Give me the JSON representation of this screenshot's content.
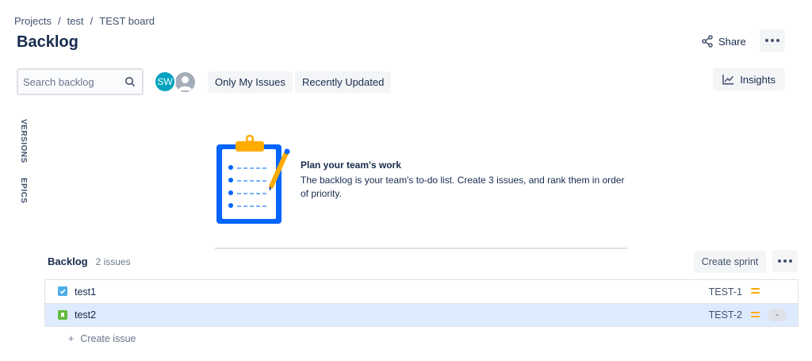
{
  "breadcrumb": {
    "items": [
      "Projects",
      "test",
      "TEST board"
    ],
    "separator": "/"
  },
  "page": {
    "title": "Backlog"
  },
  "header": {
    "share_label": "Share"
  },
  "search": {
    "placeholder": "Search backlog",
    "value": ""
  },
  "avatars": [
    {
      "initials": "SW",
      "color": "#00a3bf"
    },
    {
      "initials": "",
      "color": "#a5adba"
    }
  ],
  "filters": {
    "only_my_issues": "Only My Issues",
    "recently_updated": "Recently Updated"
  },
  "insights": {
    "label": "Insights"
  },
  "side_tabs": {
    "versions": "VERSIONS",
    "epics": "EPICS"
  },
  "empty_state": {
    "title": "Plan your team's work",
    "text": "The backlog is your team's to-do list. Create 3 issues, and rank them in order of priority."
  },
  "backlog": {
    "title": "Backlog",
    "count": "2 issues",
    "create_sprint_label": "Create sprint",
    "issues": [
      {
        "type": "task",
        "summary": "test1",
        "key": "TEST-1",
        "priority": "medium",
        "estimate": ""
      },
      {
        "type": "story",
        "summary": "test2",
        "key": "TEST-2",
        "priority": "medium",
        "estimate": "-"
      }
    ],
    "create_issue_label": "Create issue",
    "create_issue_prefix": "+"
  },
  "colors": {
    "brand": "#0052cc",
    "selected_row": "#deebff",
    "priority_medium": "#ffab00",
    "task": "#4bade8",
    "story": "#63ba3c"
  }
}
